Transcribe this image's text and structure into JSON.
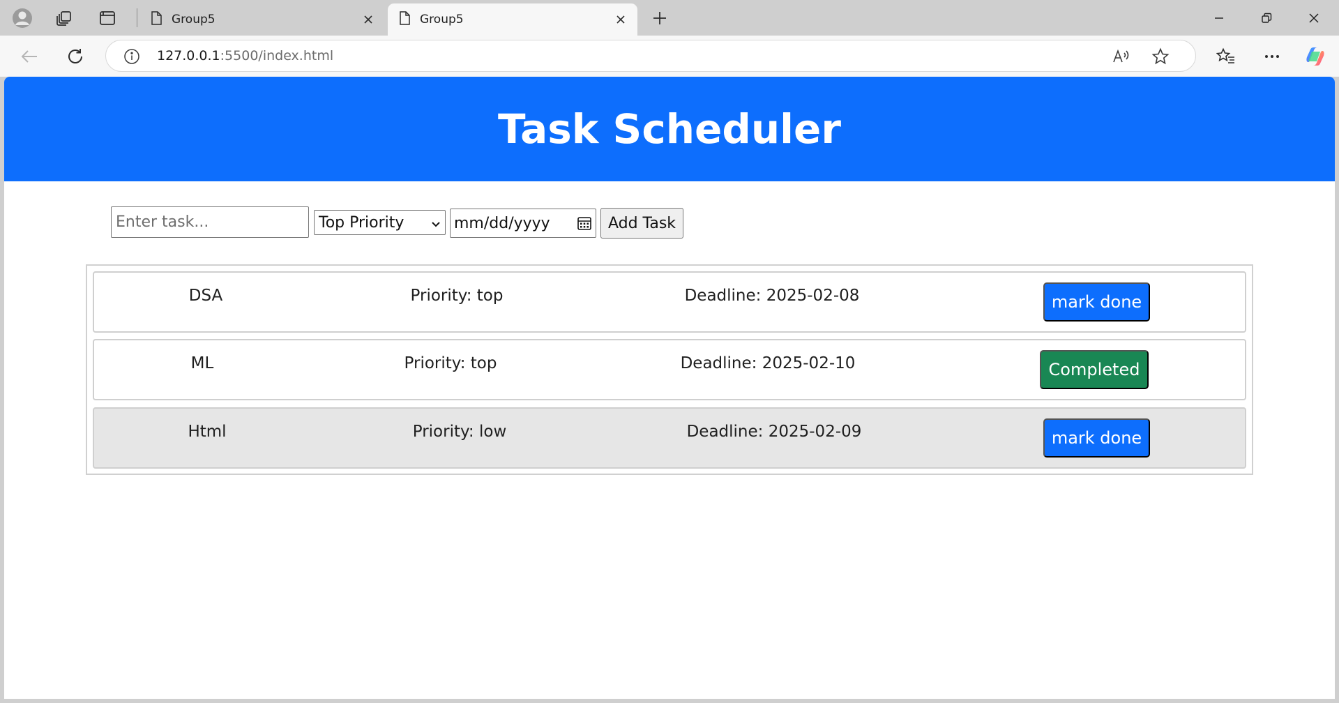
{
  "browser": {
    "tabs": [
      {
        "title": "Group5",
        "active": false
      },
      {
        "title": "Group5",
        "active": true
      }
    ],
    "url_host": "127.0.0.1",
    "url_path": ":5500/index.html"
  },
  "page": {
    "title": "Task Scheduler",
    "form": {
      "task_placeholder": "Enter task...",
      "priority_selected": "Top Priority",
      "date_placeholder": "mm/dd/yyyy",
      "add_label": "Add Task"
    },
    "tasks": [
      {
        "name": "DSA",
        "priority": "Priority: top",
        "deadline": "Deadline: 2025-02-08",
        "action": "mark done",
        "status_color": "#0d6efd"
      },
      {
        "name": "ML",
        "priority": "Priority: top",
        "deadline": "Deadline: 2025-02-10",
        "action": "Completed",
        "status_color": "#198754"
      },
      {
        "name": "Html",
        "priority": "Priority: low",
        "deadline": "Deadline: 2025-02-09",
        "action": "mark done",
        "status_color": "#0d6efd"
      }
    ]
  },
  "colors": {
    "header": "#0d6efd",
    "done": "#198754"
  }
}
